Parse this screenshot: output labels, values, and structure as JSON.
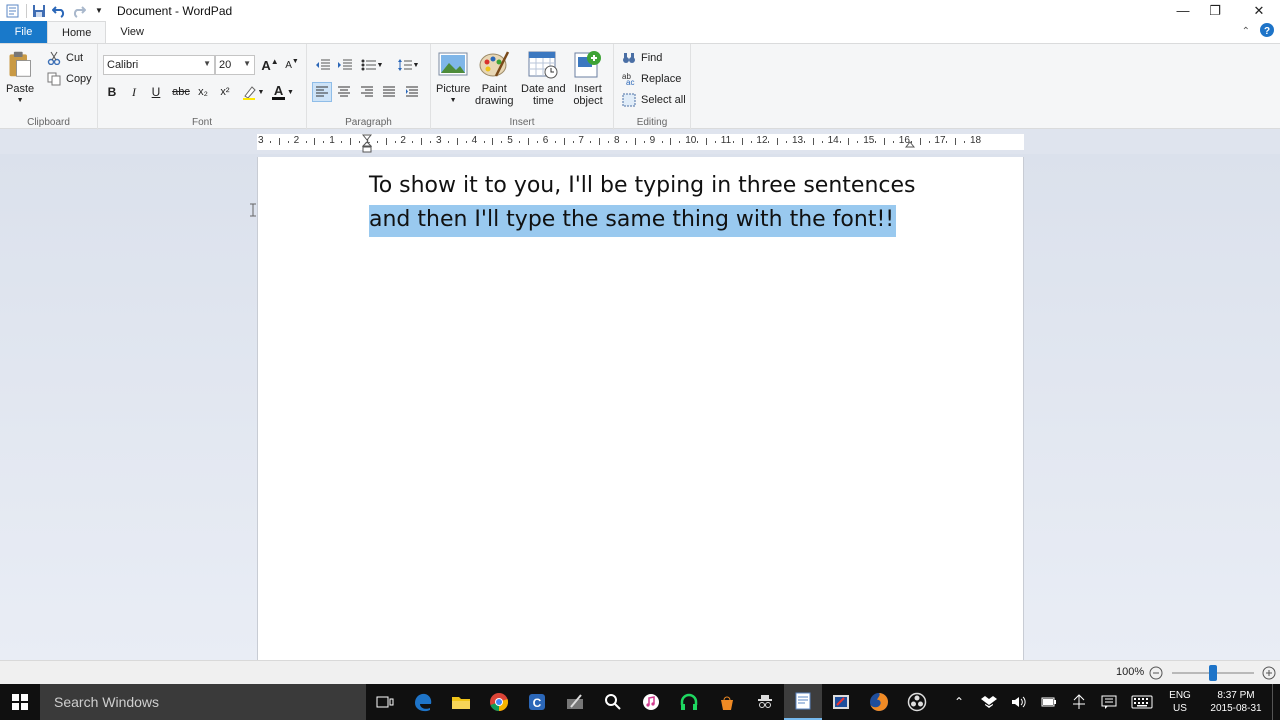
{
  "window": {
    "title": "Document - WordPad",
    "controls": {
      "minimize": "—",
      "restore": "❐",
      "close": "✕"
    }
  },
  "tabs": [
    {
      "label": "File"
    },
    {
      "label": "Home"
    },
    {
      "label": "View"
    }
  ],
  "ribbon": {
    "clipboard": {
      "paste": "Paste",
      "cut": "Cut",
      "copy": "Copy",
      "label": "Clipboard"
    },
    "font": {
      "family": "Calibri",
      "size": "20",
      "bold": "B",
      "italic": "I",
      "underline": "U",
      "strike": "abc",
      "subscript": "x₂",
      "superscript": "x²",
      "grow": "A",
      "shrink": "A",
      "color": "A",
      "label": "Font"
    },
    "paragraph": {
      "label": "Paragraph"
    },
    "insert": {
      "picture": "Picture",
      "paint_line1": "Paint",
      "paint_line2": "drawing",
      "date_line1": "Date and",
      "date_line2": "time",
      "object_line1": "Insert",
      "object_line2": "object",
      "label": "Insert"
    },
    "editing": {
      "find": "Find",
      "replace": "Replace",
      "select_all": "Select all",
      "label": "Editing"
    }
  },
  "ruler": {
    "ticks": [
      "3",
      "2",
      "1",
      "1",
      "2",
      "3",
      "4",
      "5",
      "6",
      "7",
      "8",
      "9",
      "10",
      "11",
      "12",
      "13",
      "14",
      "15",
      "16",
      "17",
      "18"
    ]
  },
  "document": {
    "line1": "To show it to you, I'll be typing in three sentences",
    "line2": "and then I'll type the same thing with the font!!"
  },
  "status": {
    "zoom": "100%",
    "zoom_level_percent": 100
  },
  "taskbar": {
    "search_placeholder": "Search Windows",
    "lang_line1": "ENG",
    "lang_line2": "US",
    "time": "8:37 PM",
    "date": "2015-08-31"
  },
  "colors": {
    "file_tab": "#1979ca",
    "selection": "#99c9ef",
    "taskbar": "#101010",
    "zoom_thumb": "#1e74c8"
  }
}
